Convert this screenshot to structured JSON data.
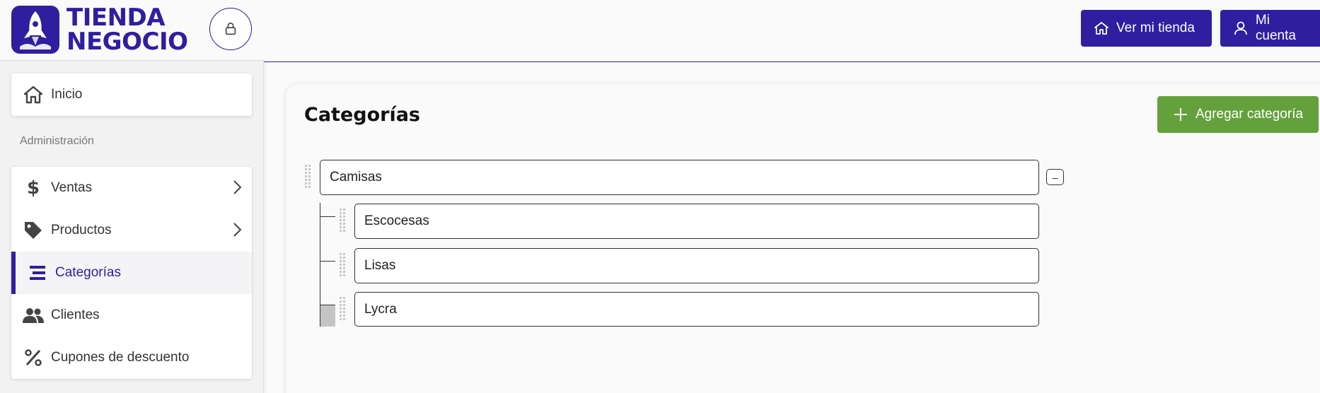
{
  "brand": {
    "line1": "TIENDA",
    "line2": "NEGOCIO"
  },
  "header": {
    "ver_tienda": "Ver mi tienda",
    "mi_cuenta": "Mi cuenta"
  },
  "sidebar": {
    "inicio": "Inicio",
    "section": "Administración",
    "items": [
      {
        "label": "Ventas",
        "icon": "dollar-icon"
      },
      {
        "label": "Productos",
        "icon": "tag-icon"
      },
      {
        "label": "Categorías",
        "icon": "list-icon"
      },
      {
        "label": "Clientes",
        "icon": "users-icon"
      },
      {
        "label": "Cupones de descuento",
        "icon": "percent-icon"
      }
    ]
  },
  "main": {
    "title": "Categorías",
    "add_button": "Agregar categoría",
    "tree": {
      "parent": {
        "label": "Camisas",
        "collapse": "–"
      },
      "children": [
        {
          "label": "Escocesas"
        },
        {
          "label": "Lisas"
        },
        {
          "label": "Lycra"
        }
      ]
    }
  },
  "colors": {
    "brand": "#2f1ea0",
    "add": "#64a13c"
  }
}
